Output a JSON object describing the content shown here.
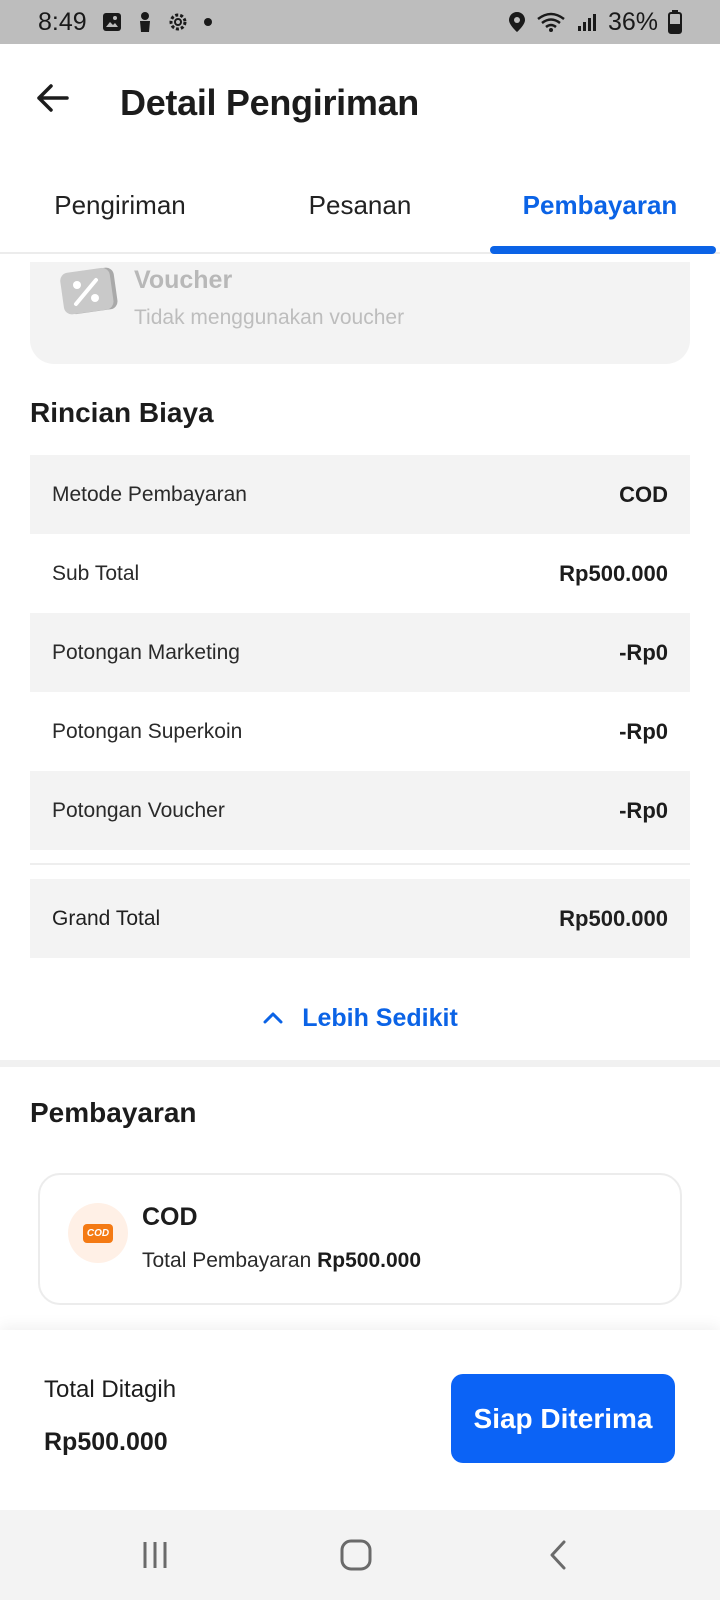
{
  "status_bar": {
    "time": "8:49",
    "battery": "36%",
    "icons": [
      "image-icon",
      "person-icon",
      "gear-icon",
      "dot-icon",
      "location-icon",
      "wifi-icon",
      "signal-icon",
      "battery-icon"
    ]
  },
  "header": {
    "title": "Detail Pengiriman",
    "back_icon": "arrow-left-icon"
  },
  "tabs": [
    {
      "label": "Pengiriman",
      "active": false
    },
    {
      "label": "Pesanan",
      "active": false
    },
    {
      "label": "Pembayaran",
      "active": true
    }
  ],
  "voucher": {
    "title": "Voucher",
    "subtitle": "Tidak menggunakan voucher",
    "icon": "percent-icon"
  },
  "cost_details": {
    "title": "Rincian Biaya",
    "rows": [
      {
        "label": "Metode Pembayaran",
        "value": "COD"
      },
      {
        "label": "Sub Total",
        "value": "Rp500.000"
      },
      {
        "label": "Potongan Marketing",
        "value": "-Rp0"
      },
      {
        "label": "Potongan Superkoin",
        "value": "-Rp0"
      },
      {
        "label": "Potongan Voucher",
        "value": "-Rp0"
      }
    ],
    "grand_total": {
      "label": "Grand Total",
      "value": "Rp500.000"
    },
    "collapse_label": "Lebih Sedikit"
  },
  "payment": {
    "title": "Pembayaran",
    "method": "COD",
    "badge": "COD",
    "total_label": "Total Pembayaran",
    "total_value": "Rp500.000"
  },
  "bottom": {
    "bill_label": "Total Ditagih",
    "bill_amount": "Rp500.000",
    "button_label": "Siap Diterima"
  },
  "colors": {
    "accent": "#0b63e6",
    "button": "#0b63f6",
    "cod_orange": "#f47a14"
  }
}
